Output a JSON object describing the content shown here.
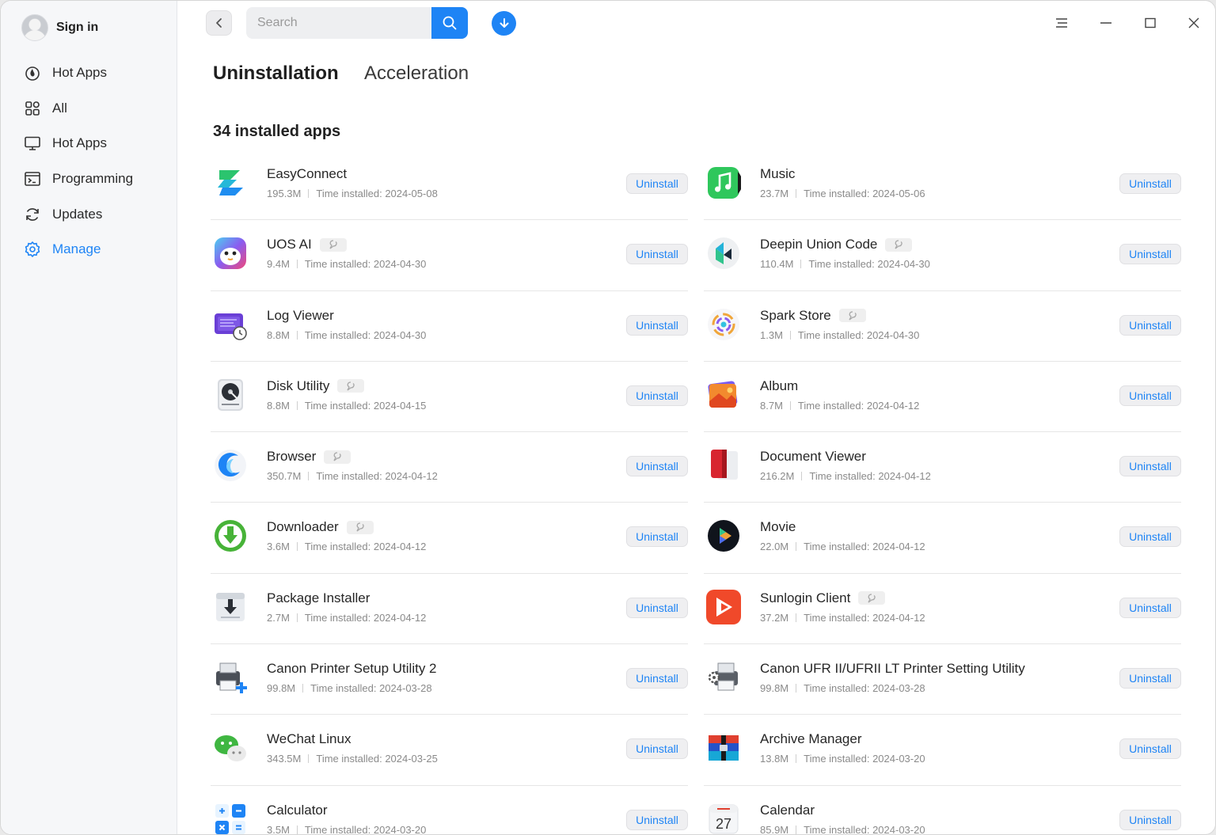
{
  "sidebar": {
    "signin_label": "Sign in",
    "items": [
      {
        "label": "Hot Apps",
        "icon": "flame-icon"
      },
      {
        "label": "All",
        "icon": "grid-icon"
      },
      {
        "label": "Hot Apps",
        "icon": "monitor-icon"
      },
      {
        "label": "Programming",
        "icon": "terminal-icon"
      },
      {
        "label": "Updates",
        "icon": "refresh-icon"
      },
      {
        "label": "Manage",
        "icon": "gear-icon",
        "active": true
      }
    ]
  },
  "toolbar": {
    "search_placeholder": "Search",
    "back_icon": "chevron-left-icon",
    "search_icon": "search-icon",
    "download_icon": "download-icon",
    "window_controls": [
      "menu-icon",
      "minimize-icon",
      "maximize-icon",
      "close-icon"
    ]
  },
  "tabs": [
    {
      "label": "Uninstallation",
      "active": true
    },
    {
      "label": "Acceleration",
      "active": false
    }
  ],
  "count_label": "34 installed apps",
  "uninstall_label": "Uninstall",
  "accent_color": "#1e84f5",
  "apps": [
    {
      "name": "EasyConnect",
      "size": "195.3M",
      "installed": "Time installed: 2024-05-08",
      "badge": false,
      "icon": "easyconnect-icon"
    },
    {
      "name": "Music",
      "size": "23.7M",
      "installed": "Time installed: 2024-05-06",
      "badge": false,
      "icon": "music-icon"
    },
    {
      "name": "UOS AI",
      "size": "9.4M",
      "installed": "Time installed: 2024-04-30",
      "badge": true,
      "icon": "uos-ai-icon"
    },
    {
      "name": "Deepin Union Code",
      "size": "110.4M",
      "installed": "Time installed: 2024-04-30",
      "badge": true,
      "icon": "union-code-icon"
    },
    {
      "name": "Log Viewer",
      "size": "8.8M",
      "installed": "Time installed: 2024-04-30",
      "badge": false,
      "icon": "log-viewer-icon"
    },
    {
      "name": "Spark Store",
      "size": "1.3M",
      "installed": "Time installed: 2024-04-30",
      "badge": true,
      "icon": "spark-store-icon"
    },
    {
      "name": "Disk Utility",
      "size": "8.8M",
      "installed": "Time installed: 2024-04-15",
      "badge": true,
      "icon": "disk-utility-icon"
    },
    {
      "name": "Album",
      "size": "8.7M",
      "installed": "Time installed: 2024-04-12",
      "badge": false,
      "icon": "album-icon"
    },
    {
      "name": "Browser",
      "size": "350.7M",
      "installed": "Time installed: 2024-04-12",
      "badge": true,
      "icon": "browser-icon"
    },
    {
      "name": "Document Viewer",
      "size": "216.2M",
      "installed": "Time installed: 2024-04-12",
      "badge": false,
      "icon": "document-viewer-icon"
    },
    {
      "name": "Downloader",
      "size": "3.6M",
      "installed": "Time installed: 2024-04-12",
      "badge": true,
      "icon": "downloader-icon"
    },
    {
      "name": "Movie",
      "size": "22.0M",
      "installed": "Time installed: 2024-04-12",
      "badge": false,
      "icon": "movie-icon"
    },
    {
      "name": "Package Installer",
      "size": "2.7M",
      "installed": "Time installed: 2024-04-12",
      "badge": false,
      "icon": "package-installer-icon"
    },
    {
      "name": "Sunlogin Client",
      "size": "37.2M",
      "installed": "Time installed: 2024-04-12",
      "badge": true,
      "icon": "sunlogin-icon"
    },
    {
      "name": "Canon Printer Setup Utility 2",
      "size": "99.8M",
      "installed": "Time installed: 2024-03-28",
      "badge": false,
      "icon": "printer-setup-icon"
    },
    {
      "name": "Canon UFR II/UFRII LT Printer Setting Utility",
      "size": "99.8M",
      "installed": "Time installed: 2024-03-28",
      "badge": false,
      "icon": "printer-setting-icon"
    },
    {
      "name": "WeChat Linux",
      "size": "343.5M",
      "installed": "Time installed: 2024-03-25",
      "badge": false,
      "icon": "wechat-icon"
    },
    {
      "name": "Archive Manager",
      "size": "13.8M",
      "installed": "Time installed: 2024-03-20",
      "badge": false,
      "icon": "archive-manager-icon"
    },
    {
      "name": "Calculator",
      "size": "3.5M",
      "installed": "Time installed: 2024-03-20",
      "badge": false,
      "icon": "calculator-icon"
    },
    {
      "name": "Calendar",
      "size": "85.9M",
      "installed": "Time installed: 2024-03-20",
      "badge": false,
      "icon": "calendar-icon",
      "icon_text": "27"
    }
  ]
}
